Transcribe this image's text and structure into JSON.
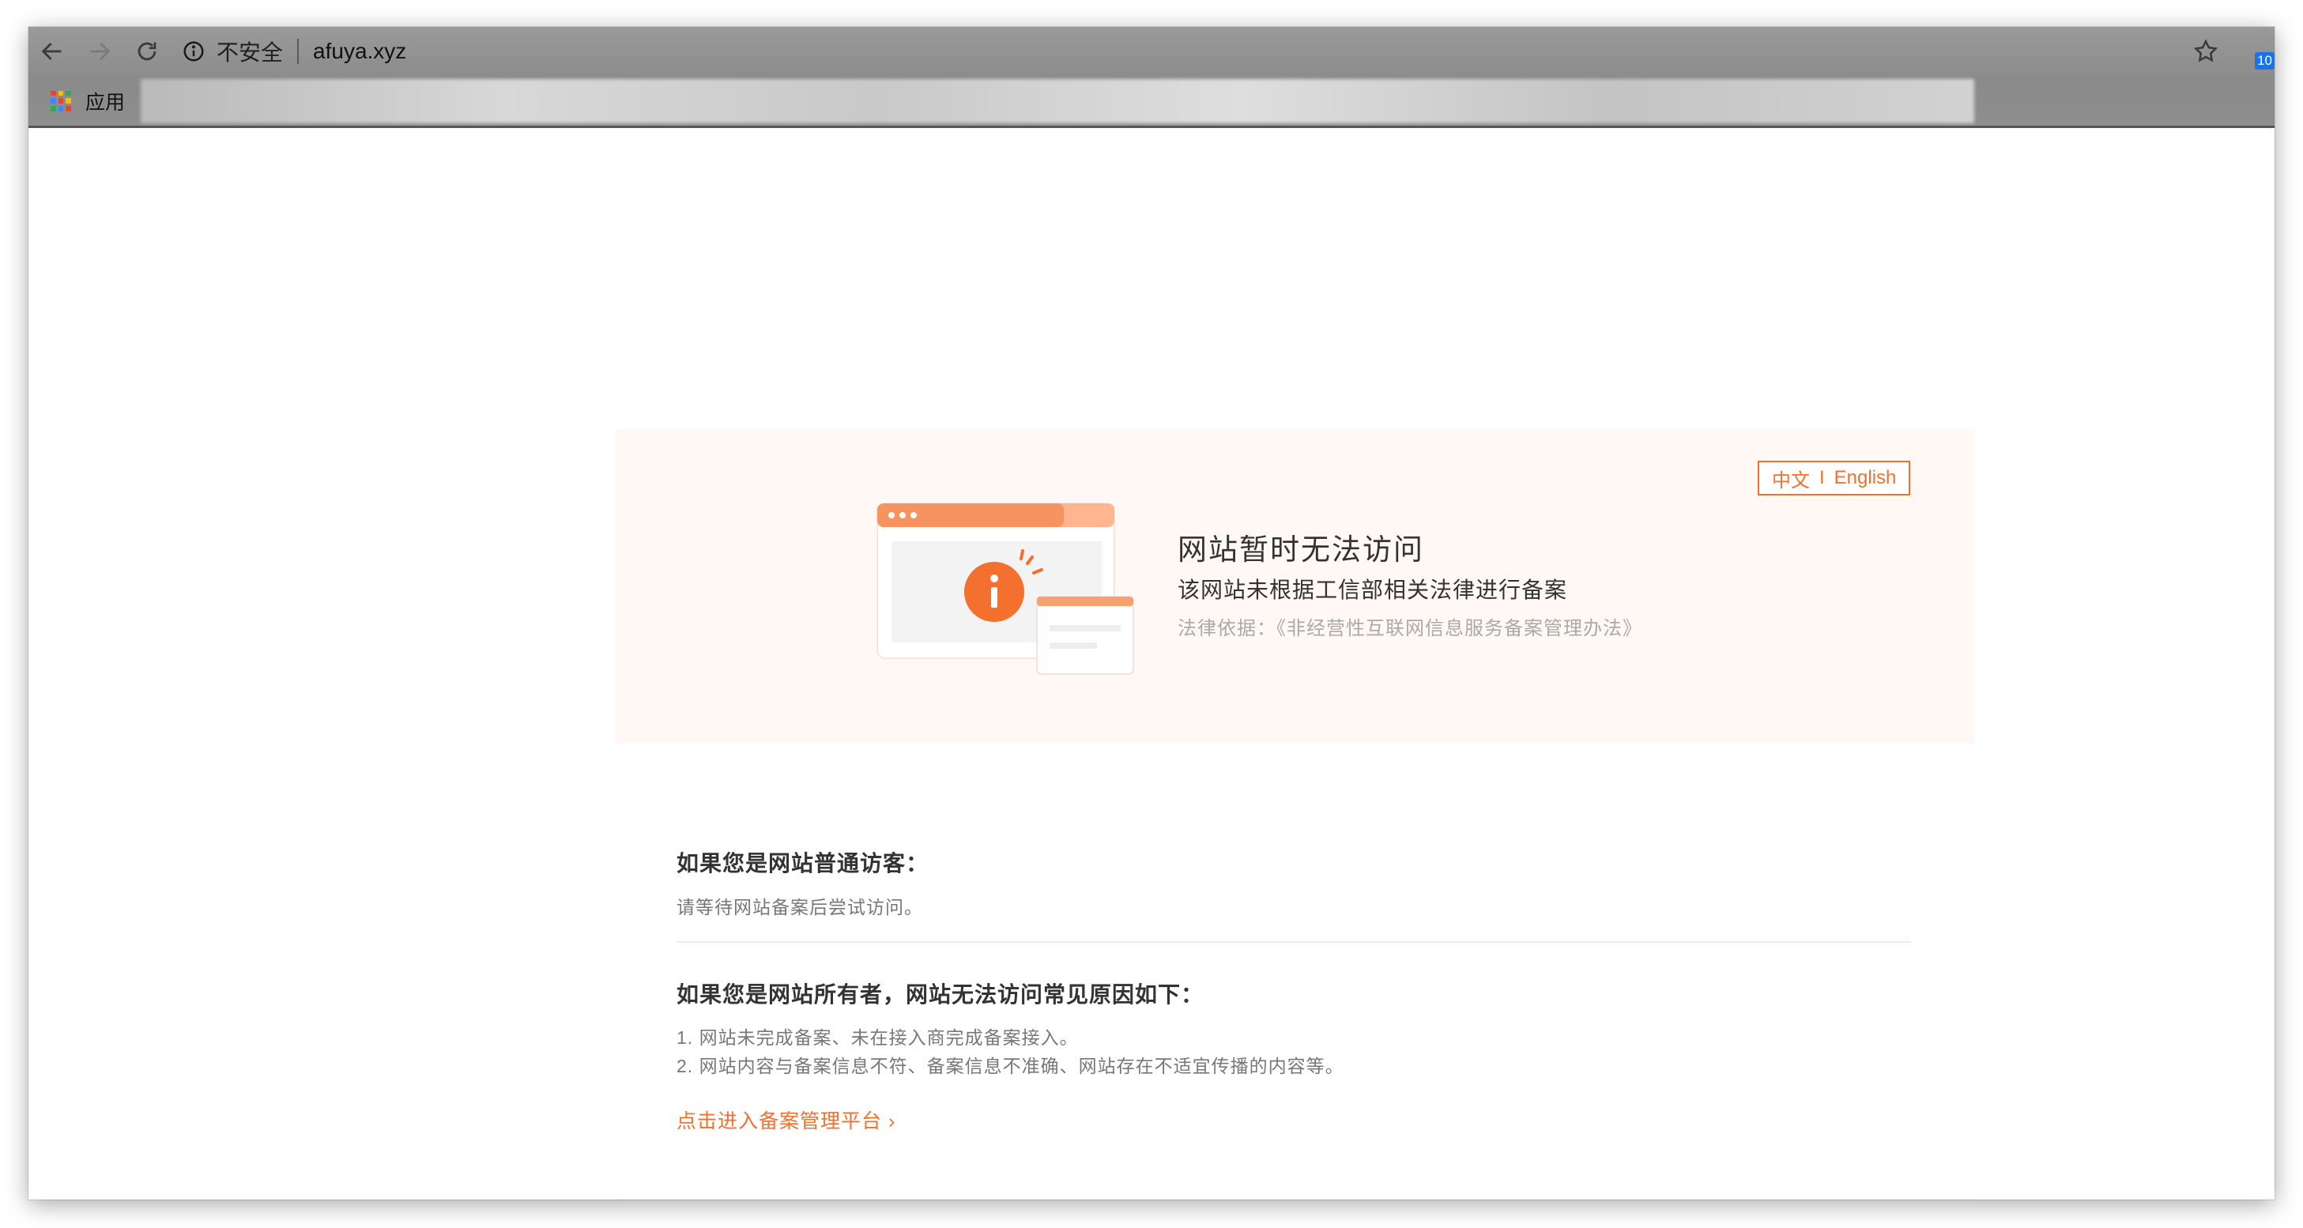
{
  "browser": {
    "security_label": "不安全",
    "url": "afuya.xyz",
    "apps_label": "应用",
    "ext_badge": "10"
  },
  "banner": {
    "lang_zh": "中文",
    "lang_sep": "I",
    "lang_en": "English",
    "title": "网站暂时无法访问",
    "subtitle": "该网站未根据工信部相关法律进行备案",
    "law": "法律依据：《非经营性互联网信息服务备案管理办法》"
  },
  "visitor": {
    "heading": "如果您是网站普通访客：",
    "text": "请等待网站备案后尝试访问。"
  },
  "owner": {
    "heading": "如果您是网站所有者，网站无法访问常见原因如下：",
    "items": [
      "1. 网站未完成备案、未在接入商完成备案接入。",
      "2. 网站内容与备案信息不符、备案信息不准确、网站存在不适宜传播的内容等。"
    ],
    "link": "点击进入备案管理平台 ›"
  },
  "colors": {
    "accent": "#f3702e",
    "banner_bg": "#fff8f4"
  }
}
